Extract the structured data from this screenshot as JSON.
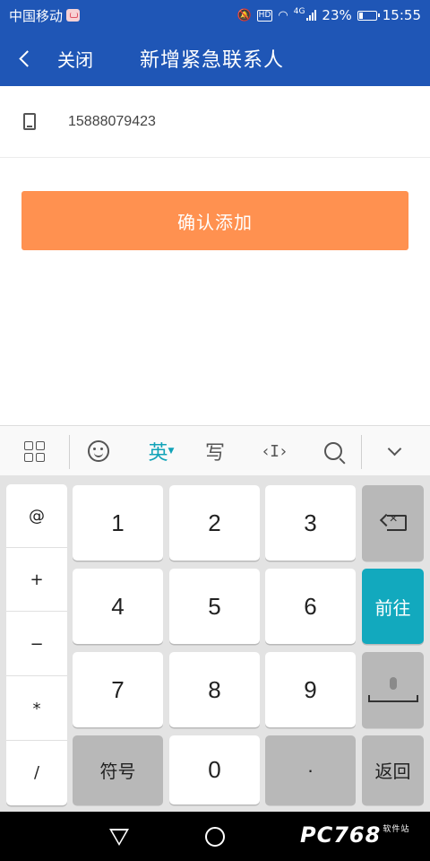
{
  "status_bar": {
    "carrier": "中国移动",
    "hd": "HD",
    "network": "4G",
    "battery": "23%",
    "time": "15:55"
  },
  "header": {
    "close_label": "关闭",
    "title": "新增紧急联系人"
  },
  "form": {
    "phone_value": "15888079423",
    "confirm_label": "确认添加"
  },
  "keyboard_toolbar": {
    "lang_label": "英",
    "handwrite_label": "写",
    "cursor_label": "‹I›"
  },
  "keyboard": {
    "symbols": [
      "@",
      "+",
      "−",
      "*",
      "/"
    ],
    "digits": [
      "1",
      "2",
      "3",
      "4",
      "5",
      "6",
      "7",
      "8",
      "9"
    ],
    "symbols_key": "符号",
    "zero": "0",
    "dot": "·",
    "go_label": "前往",
    "return_label": "返回"
  },
  "watermark": {
    "text": "PC768",
    "sub": "软件站"
  }
}
